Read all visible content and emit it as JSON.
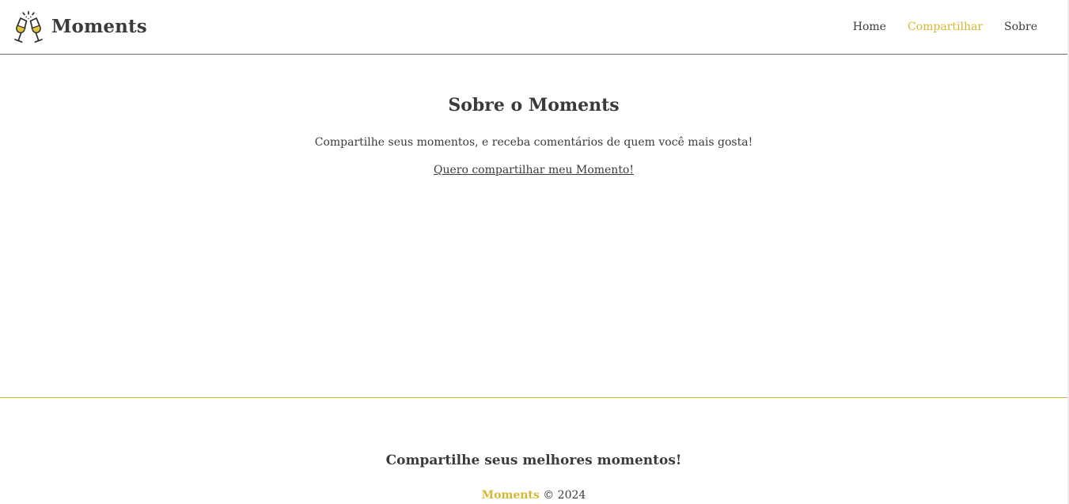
{
  "colors": {
    "accent": "#d6b730",
    "text": "#3b3b3b",
    "header_border": "#707070"
  },
  "header": {
    "logo_icon": "champagne-toast-icon",
    "brand": "Moments",
    "nav": [
      {
        "label": "Home",
        "active": false
      },
      {
        "label": "Compartilhar",
        "active": true
      },
      {
        "label": "Sobre",
        "active": false
      }
    ]
  },
  "main": {
    "title": "Sobre o Moments",
    "text": "Compartilhe seus momentos, e receba comentários de quem você mais gosta!",
    "link": "Quero compartilhar meu Momento!"
  },
  "footer": {
    "title": "Compartilhe seus melhores momentos!",
    "brand": "Moments",
    "copyright": "© 2024"
  }
}
